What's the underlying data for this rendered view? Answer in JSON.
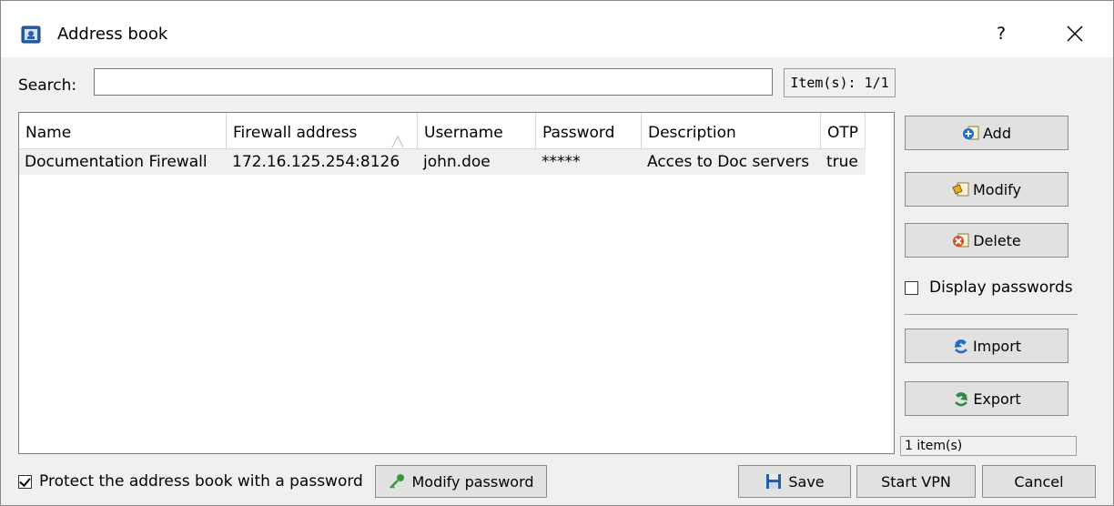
{
  "window": {
    "title": "Address book",
    "help_label": "?"
  },
  "search": {
    "label": "Search:",
    "value": "",
    "placeholder": "",
    "items_count": "Item(s): 1/1"
  },
  "table": {
    "columns": [
      "Name",
      "Firewall address",
      "Username",
      "Password",
      "Description",
      "OTP"
    ],
    "sorted_column": "Firewall address",
    "rows": [
      [
        "Documentation Firewall",
        "172.16.125.254:8126",
        "john.doe",
        "*****",
        "Acces to Doc servers",
        "true"
      ]
    ]
  },
  "side": {
    "add_label": "Add",
    "modify_label": "Modify",
    "delete_label": "Delete",
    "display_passwords_label": "Display passwords",
    "display_passwords_checked": false,
    "import_label": "Import",
    "export_label": "Export",
    "status_text": "1 item(s)"
  },
  "footer": {
    "protect_label": "Protect the address book with a password",
    "protect_checked": true,
    "modify_password_label": "Modify password",
    "save_label": "Save",
    "start_vpn_label": "Start VPN",
    "cancel_label": "Cancel"
  },
  "icons": {
    "app": "address-book-icon",
    "close": "close-icon",
    "sort": "sort-ascending-icon",
    "add": "add-icon",
    "modify": "modify-icon",
    "delete": "delete-icon",
    "import": "import-icon",
    "export": "export-icon",
    "key": "key-icon",
    "save": "floppy-disk-icon"
  },
  "colors": {
    "window_bg": "#f0f0f0",
    "button_bg": "#e1e1e1",
    "row_selected_bg": "#f0f0f0",
    "accent_blue": "#1f6fc0"
  }
}
